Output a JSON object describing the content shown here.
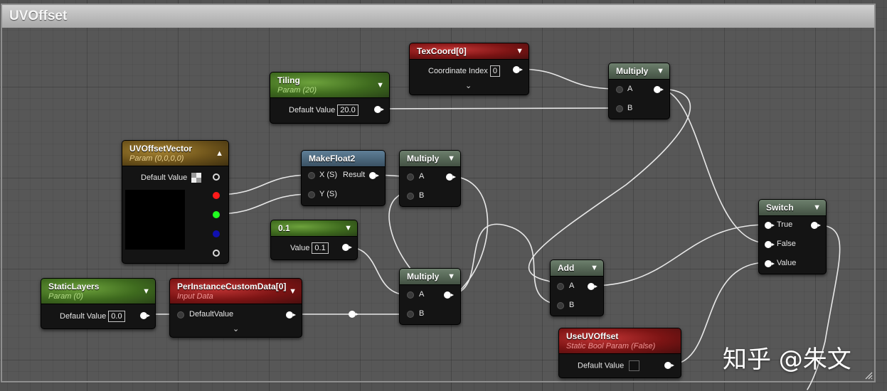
{
  "comment": {
    "title": "UVOffset"
  },
  "nodes": {
    "texcoord": {
      "title": "TexCoord[0]",
      "label": "Coordinate Index",
      "value": "0",
      "expand": "⌄"
    },
    "tiling": {
      "title": "Tiling",
      "subtitle": "Param (20)",
      "label": "Default Value",
      "value": "20.0"
    },
    "multiply_top": {
      "title": "Multiply",
      "pin_a": "A",
      "pin_b": "B"
    },
    "uvoffsetvector": {
      "title": "UVOffsetVector",
      "subtitle": "Param (0,0,0,0)",
      "label": "Default Value"
    },
    "makefloat2": {
      "title": "MakeFloat2",
      "pin_x": "X (S)",
      "pin_y": "Y (S)",
      "result": "Result"
    },
    "multiply_mid": {
      "title": "Multiply",
      "pin_a": "A",
      "pin_b": "B"
    },
    "const": {
      "title": "0.1",
      "label": "Value",
      "value": "0.1"
    },
    "multiply_low": {
      "title": "Multiply",
      "pin_a": "A",
      "pin_b": "B"
    },
    "staticlayers": {
      "title": "StaticLayers",
      "subtitle": "Param (0)",
      "label": "Default Value",
      "value": "0.0"
    },
    "perinstance": {
      "title": "PerInstanceCustomData[0]",
      "subtitle": "Input Data",
      "label": "DefaultValue",
      "expand": "⌄"
    },
    "add": {
      "title": "Add",
      "pin_a": "A",
      "pin_b": "B"
    },
    "switch": {
      "title": "Switch",
      "pin_true": "True",
      "pin_false": "False",
      "pin_value": "Value"
    },
    "useuvoffset": {
      "title": "UseUVOffset",
      "subtitle": "Static Bool Param (False)",
      "label": "Default Value"
    }
  },
  "watermark": "知乎 @朱文",
  "colors": {
    "param_green": "#4a7a2a",
    "input_red": "#8a1a1a",
    "vector_gold": "#7a5e20",
    "func_blue": "#4a6378",
    "pin_red": "#ff1a1a",
    "pin_green": "#20ff20",
    "pin_blue": "#1010b0"
  },
  "icons": {
    "collapse": "chevron-down-icon",
    "expand": "chevron-up-icon",
    "checker": "checkerboard-icon"
  }
}
